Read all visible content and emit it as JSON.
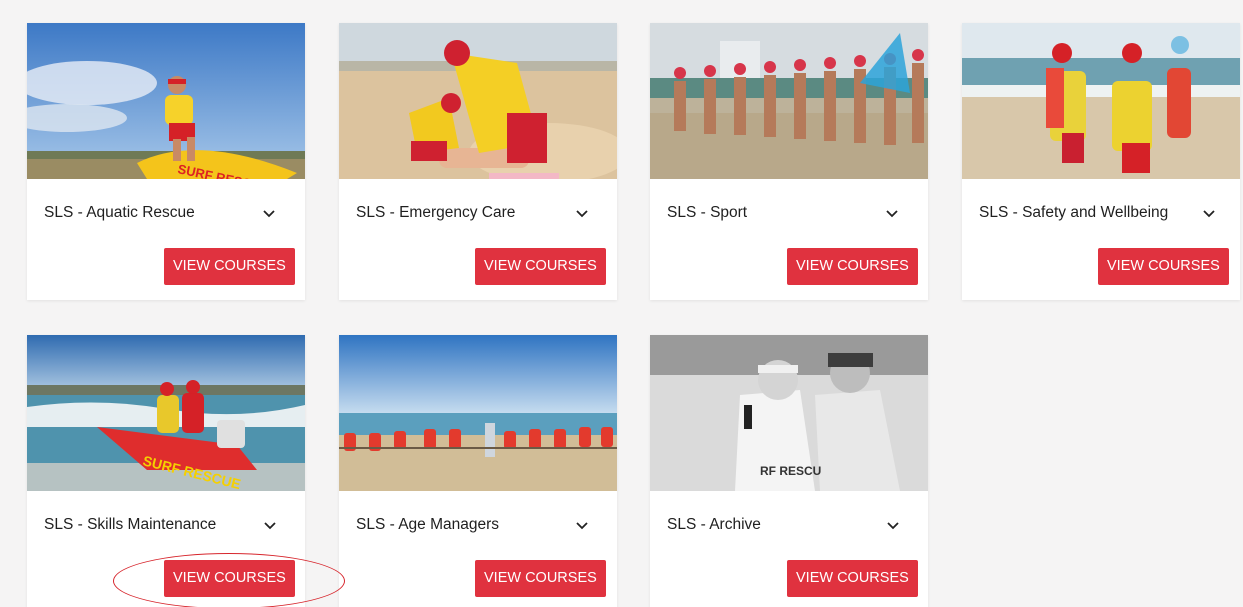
{
  "cards": [
    {
      "title": "SLS - Aquatic Rescue",
      "button": "VIEW COURSES",
      "photo": "aquatic-rescue-photo"
    },
    {
      "title": "SLS - Emergency Care",
      "button": "VIEW COURSES",
      "photo": "emergency-care-photo"
    },
    {
      "title": "SLS - Sport",
      "button": "VIEW COURSES",
      "photo": "sport-photo"
    },
    {
      "title": "SLS - Safety and Wellbeing",
      "button": "VIEW COURSES",
      "photo": "safety-wellbeing-photo"
    },
    {
      "title": "SLS - Skills Maintenance",
      "button": "VIEW COURSES",
      "photo": "skills-maintenance-photo"
    },
    {
      "title": "SLS - Age Managers",
      "button": "VIEW COURSES",
      "photo": "age-managers-photo"
    },
    {
      "title": "SLS - Archive",
      "button": "VIEW COURSES",
      "photo": "archive-photo"
    }
  ],
  "icons": {
    "expand": "chevron-down-icon"
  },
  "colors": {
    "button": "#e0323f",
    "annotation": "#d7262d",
    "background": "#f5f4f4"
  }
}
